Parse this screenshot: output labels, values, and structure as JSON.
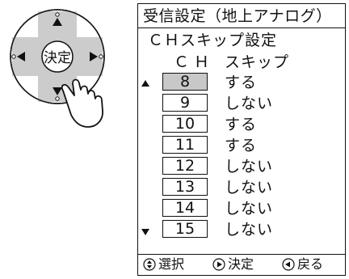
{
  "remote": {
    "center_label": "決定"
  },
  "osd": {
    "title": "受信設定（地上アナログ）",
    "subtitle": "ＣＨスキップ設定",
    "header_ch": "ＣＨ",
    "header_skip": "スキップ",
    "rows": [
      {
        "ch": "8",
        "skip": "する",
        "selected": true
      },
      {
        "ch": "9",
        "skip": "しない",
        "selected": false
      },
      {
        "ch": "10",
        "skip": "する",
        "selected": false
      },
      {
        "ch": "11",
        "skip": "する",
        "selected": false
      },
      {
        "ch": "12",
        "skip": "しない",
        "selected": false
      },
      {
        "ch": "13",
        "skip": "しない",
        "selected": false
      },
      {
        "ch": "14",
        "skip": "しない",
        "selected": false
      },
      {
        "ch": "15",
        "skip": "しない",
        "selected": false
      }
    ],
    "footer": {
      "select_label": "選択",
      "confirm_label": "決定",
      "back_label": "戻る"
    }
  },
  "colors": {
    "selected_row": "#c8c8c8",
    "remote_bar": "#cccccc",
    "line": "#111111"
  },
  "icons": [
    "up-down-icon",
    "right-icon",
    "left-icon",
    "scroll-up-arrow-icon",
    "scroll-down-arrow-icon",
    "hand-pointer-icon"
  ]
}
